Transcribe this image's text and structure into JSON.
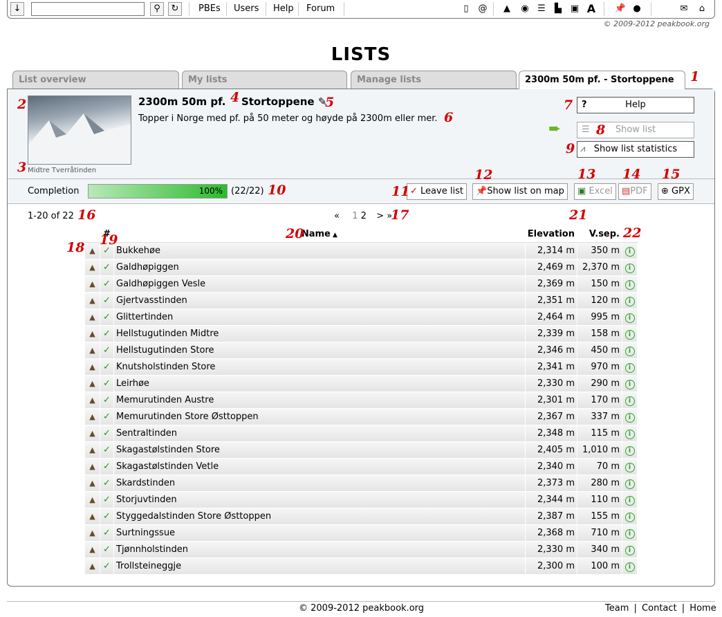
{
  "toolbar": {
    "search_value": "",
    "links": [
      "PBEs",
      "Users",
      "Help",
      "Forum"
    ],
    "copyright": "© 2009-2012 peakbook.org"
  },
  "page_title": "LISTS",
  "tabs": [
    "List overview",
    "My lists",
    "Manage lists",
    "2300m 50m pf. - Stortoppene"
  ],
  "list": {
    "title_part1": "2300m 50m pf.",
    "title_part2": "Stortoppene",
    "description": "Topper i Norge med pf. på 50 meter og høyde på 2300m eller mer.",
    "photo_caption": "Midtre Tverråtinden"
  },
  "side_buttons": {
    "help": "Help",
    "show_list": "Show list",
    "show_stats": "Show list statistics"
  },
  "completion": {
    "label": "Completion",
    "percent_text": "100%",
    "percent": 100,
    "count": "(22/22)"
  },
  "actions": {
    "leave": "Leave list",
    "map": "Show list on map",
    "excel": "Excel",
    "pdf": "PDF",
    "gpx": "GPX"
  },
  "pagination": {
    "range": "1-20 of 22",
    "first": "«",
    "page1": "1",
    "page2": "2",
    "next": ">",
    "last": "»"
  },
  "table": {
    "headers": {
      "num": "#",
      "name": "Name",
      "elev": "Elevation",
      "vsep": "V.sep."
    },
    "rows": [
      {
        "name": "Bukkehøe",
        "elev": "2,314 m",
        "vsep": "350 m"
      },
      {
        "name": "Galdhøpiggen",
        "elev": "2,469 m",
        "vsep": "2,370 m"
      },
      {
        "name": "Galdhøpiggen Vesle",
        "elev": "2,369 m",
        "vsep": "150 m"
      },
      {
        "name": "Gjertvasstinden",
        "elev": "2,351 m",
        "vsep": "120 m"
      },
      {
        "name": "Glittertinden",
        "elev": "2,464 m",
        "vsep": "995 m"
      },
      {
        "name": "Hellstugutinden Midtre",
        "elev": "2,339 m",
        "vsep": "158 m"
      },
      {
        "name": "Hellstugutinden Store",
        "elev": "2,346 m",
        "vsep": "450 m"
      },
      {
        "name": "Knutsholstinden Store",
        "elev": "2,341 m",
        "vsep": "970 m"
      },
      {
        "name": "Leirhøe",
        "elev": "2,330 m",
        "vsep": "290 m"
      },
      {
        "name": "Memurutinden Austre",
        "elev": "2,301 m",
        "vsep": "170 m"
      },
      {
        "name": "Memurutinden Store Østtoppen",
        "elev": "2,367 m",
        "vsep": "337 m"
      },
      {
        "name": "Sentraltinden",
        "elev": "2,348 m",
        "vsep": "115 m"
      },
      {
        "name": "Skagastølstinden Store",
        "elev": "2,405 m",
        "vsep": "1,010 m"
      },
      {
        "name": "Skagastølstinden Vetle",
        "elev": "2,340 m",
        "vsep": "70 m"
      },
      {
        "name": "Skardstinden",
        "elev": "2,373 m",
        "vsep": "280 m"
      },
      {
        "name": "Storjuvtinden",
        "elev": "2,344 m",
        "vsep": "110 m"
      },
      {
        "name": "Styggedalstinden Store Østtoppen",
        "elev": "2,387 m",
        "vsep": "155 m"
      },
      {
        "name": "Surtningssue",
        "elev": "2,368 m",
        "vsep": "710 m"
      },
      {
        "name": "Tjønnholstinden",
        "elev": "2,330 m",
        "vsep": "340 m"
      },
      {
        "name": "Trollsteineggje",
        "elev": "2,300 m",
        "vsep": "100 m"
      }
    ]
  },
  "footer": {
    "copyright": "© 2009-2012 peakbook.org",
    "links": [
      "Team",
      "Contact",
      "Home"
    ],
    "sep": "|"
  },
  "annotations": [
    "1",
    "2",
    "3",
    "4",
    "5",
    "6",
    "7",
    "8",
    "9",
    "10",
    "11",
    "12",
    "13",
    "14",
    "15",
    "16",
    "17",
    "18",
    "19",
    "20",
    "21",
    "22"
  ]
}
